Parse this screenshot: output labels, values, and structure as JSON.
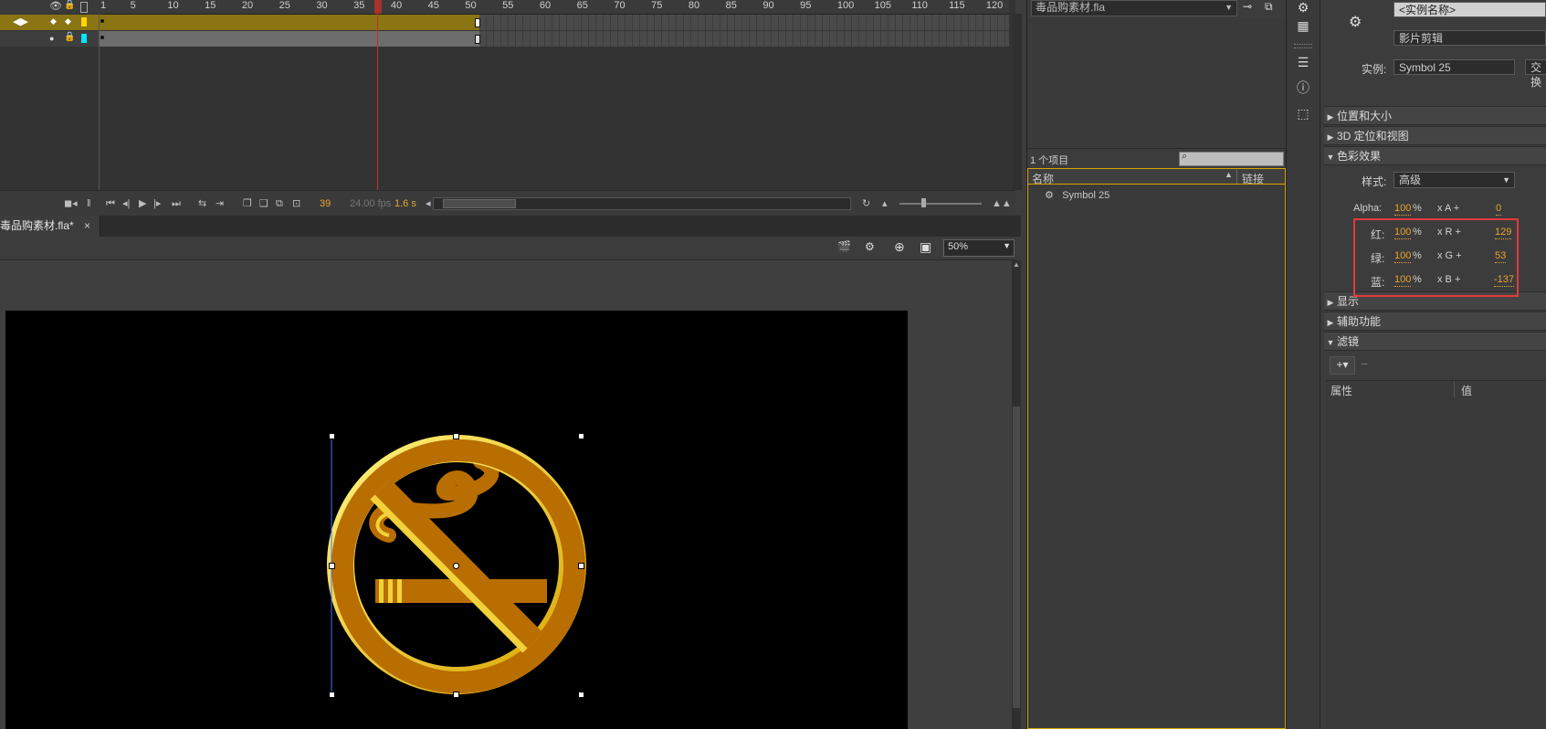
{
  "timeline": {
    "ruler_ticks": [
      "1",
      "5",
      "10",
      "15",
      "20",
      "25",
      "30",
      "35",
      "40",
      "45",
      "50",
      "55",
      "60",
      "65",
      "70",
      "75",
      "80",
      "85",
      "90",
      "95",
      "100",
      "105",
      "110",
      "115",
      "120"
    ],
    "current_frame": "39",
    "fps": "24.00 fps",
    "elapsed": "1.6 s"
  },
  "document": {
    "tab_label": "毒品购素材.fla*",
    "tab_close": "×",
    "zoom": "50%"
  },
  "library": {
    "doc_select": "毒品购素材.fla",
    "item_count": "1 个项目",
    "col_name": "名称",
    "col_linkage": "链接",
    "items": [
      {
        "name": "Symbol 25"
      }
    ]
  },
  "properties": {
    "instance_name_placeholder": "<实例名称>",
    "symbol_type": "影片剪辑",
    "instance_label": "实例:",
    "instance_value": "Symbol 25",
    "swap_button": "交换",
    "sections": {
      "position_size": "位置和大小",
      "three_d": "3D 定位和视图",
      "color_effect": "色彩效果",
      "display": "显示",
      "accessibility": "辅助功能",
      "filters": "滤镜"
    },
    "style_label": "样式:",
    "style_value": "高级",
    "color_rows": [
      {
        "label": "Alpha:",
        "percent": "100",
        "unit": "%",
        "mult": "x A +",
        "offset": "0"
      },
      {
        "label": "红:",
        "percent": "100",
        "unit": "%",
        "mult": "x R +",
        "offset": "129"
      },
      {
        "label": "绿:",
        "percent": "100",
        "unit": "%",
        "mult": "x G +",
        "offset": "53"
      },
      {
        "label": "蓝:",
        "percent": "100",
        "unit": "%",
        "mult": "x B +",
        "offset": "-137"
      }
    ],
    "filter_col_property": "属性",
    "filter_col_value": "值"
  },
  "colors": {
    "accent_yellow": "#d7a400",
    "value_orange": "#e7a52f",
    "highlight_red": "#e03a3a",
    "sign_orange": "#b86e00",
    "sign_gold": "#f2d23a"
  }
}
